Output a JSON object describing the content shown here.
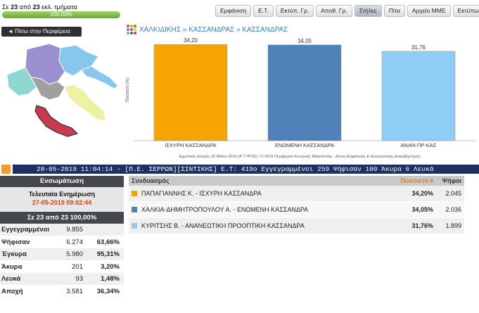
{
  "header": {
    "sections_prefix": "Σε",
    "sections_done": "23",
    "sections_mid": "από",
    "sections_total": "23",
    "sections_suffix": "εκλ. τμήματα",
    "progress_text": "100.00%",
    "progress_fraction": 1.0
  },
  "toolbar": [
    "Εμφάνιση",
    "Ε.Τ.",
    "Εκτύπ. Γρ.",
    "Αποθ. Γρ.",
    "Στήλες",
    "Πίτα",
    "Αρχείο ΜΜΕ",
    "Εκτύπωση"
  ],
  "toolbar_active": "Στήλες",
  "back_button": "◄ Πίσω στην Περιφέρεια",
  "breadcrumb": "ΧΑΛΚΙΔΙΚΗΣ » ΚΑΣΣΑΝΔΡΑΣ » ΚΑΣΣΑΝΔΡΑΣ",
  "chart_data": {
    "type": "bar",
    "categories": [
      "ΙΣΧΥΡΗ ΚΑΣΣΑΝΔΡΑ",
      "ΕΝΩΜΕΝΗ ΚΑΣΣΑΝΔΡΑ",
      "ΑΝΑΝ-ΠΡ-ΚΑΣ"
    ],
    "values": [
      34.2,
      34.05,
      31.76
    ],
    "value_labels": [
      "34,20",
      "34,05",
      "31,76"
    ],
    "colors": [
      "#f6a400",
      "#4f82b8",
      "#8ecdf6"
    ],
    "ylabel": "Ποσοστό (%)",
    "ylim": [
      0,
      36
    ],
    "grid": false,
    "legend": "none"
  },
  "chart_footer": "Δημοτικές εκλογές 26 Μαΐου 2019 (Α' ΓΥΡΟΣ) / © 2019 Περιφέρεια Κεντρικής Μακεδονίας - Δ/νση Διαφάνειας & Ηλεκτρονικής Διακυβέρνησης",
  "ticker": "28-05-2019 11:04:14 - [Π.Ε. ΣΕΡΡΩΝ][ΣΙΝΤΙΚΗΣ] Ε.Τ: 419ο Εγγεγραμμένοι 259 Ψήφισαν 100 Άκυρα 6 Λευκά",
  "summary": {
    "title": "Ενσωμάτωση",
    "update_label": "Τελευταία Ενημέρωση",
    "update_time": "27-05-2019 09:02:44",
    "count_line": "Σε 23  από  23    100,00%",
    "rows": [
      {
        "label": "Εγγεγραμμένοι",
        "value": "9.855",
        "pct": ""
      },
      {
        "label": "Ψήφισαν",
        "value": "6.274",
        "pct": "63,66%"
      },
      {
        "label": "Έγκυρα",
        "value": "5.980",
        "pct": "95,31%"
      },
      {
        "label": "Άκυρα",
        "value": "201",
        "pct": "3,20%"
      },
      {
        "label": "Λευκά",
        "value": "93",
        "pct": "1,48%"
      },
      {
        "label": "Αποχή",
        "value": "3.581",
        "pct": "36,34%"
      }
    ]
  },
  "results": {
    "headers": {
      "party": "Συνδυασμός",
      "pct": "Ποσοστό ▾",
      "votes": "Ψήφοι"
    },
    "rows": [
      {
        "name": "ΠΑΠΑΓΙΑΝΝΗΣ Κ. - ΙΣΧΥΡΗ ΚΑΣΣΑΝΔΡΑ",
        "pct": "34,20%",
        "votes": "2.045",
        "color": "#f6a400"
      },
      {
        "name": "ΧΑΛΚΙΑ-ΔΗΜΗΤΡΟΠΟΥΛΟΥ Α. - ΕΝΩΜΕΝΗ ΚΑΣΣΑΝΔΡΑ",
        "pct": "34,05%",
        "votes": "2.036",
        "color": "#4f82b8"
      },
      {
        "name": "ΚΥΡΙΤΣΗΣ Β. - ΑΝΑΝΕΩΤΙΚΗ ΠΡΟΟΠΤΙΚΗ ΚΑΣΣΑΝΔΡΑ",
        "pct": "31,76%",
        "votes": "1.899",
        "color": "#8ecdf6"
      }
    ]
  }
}
